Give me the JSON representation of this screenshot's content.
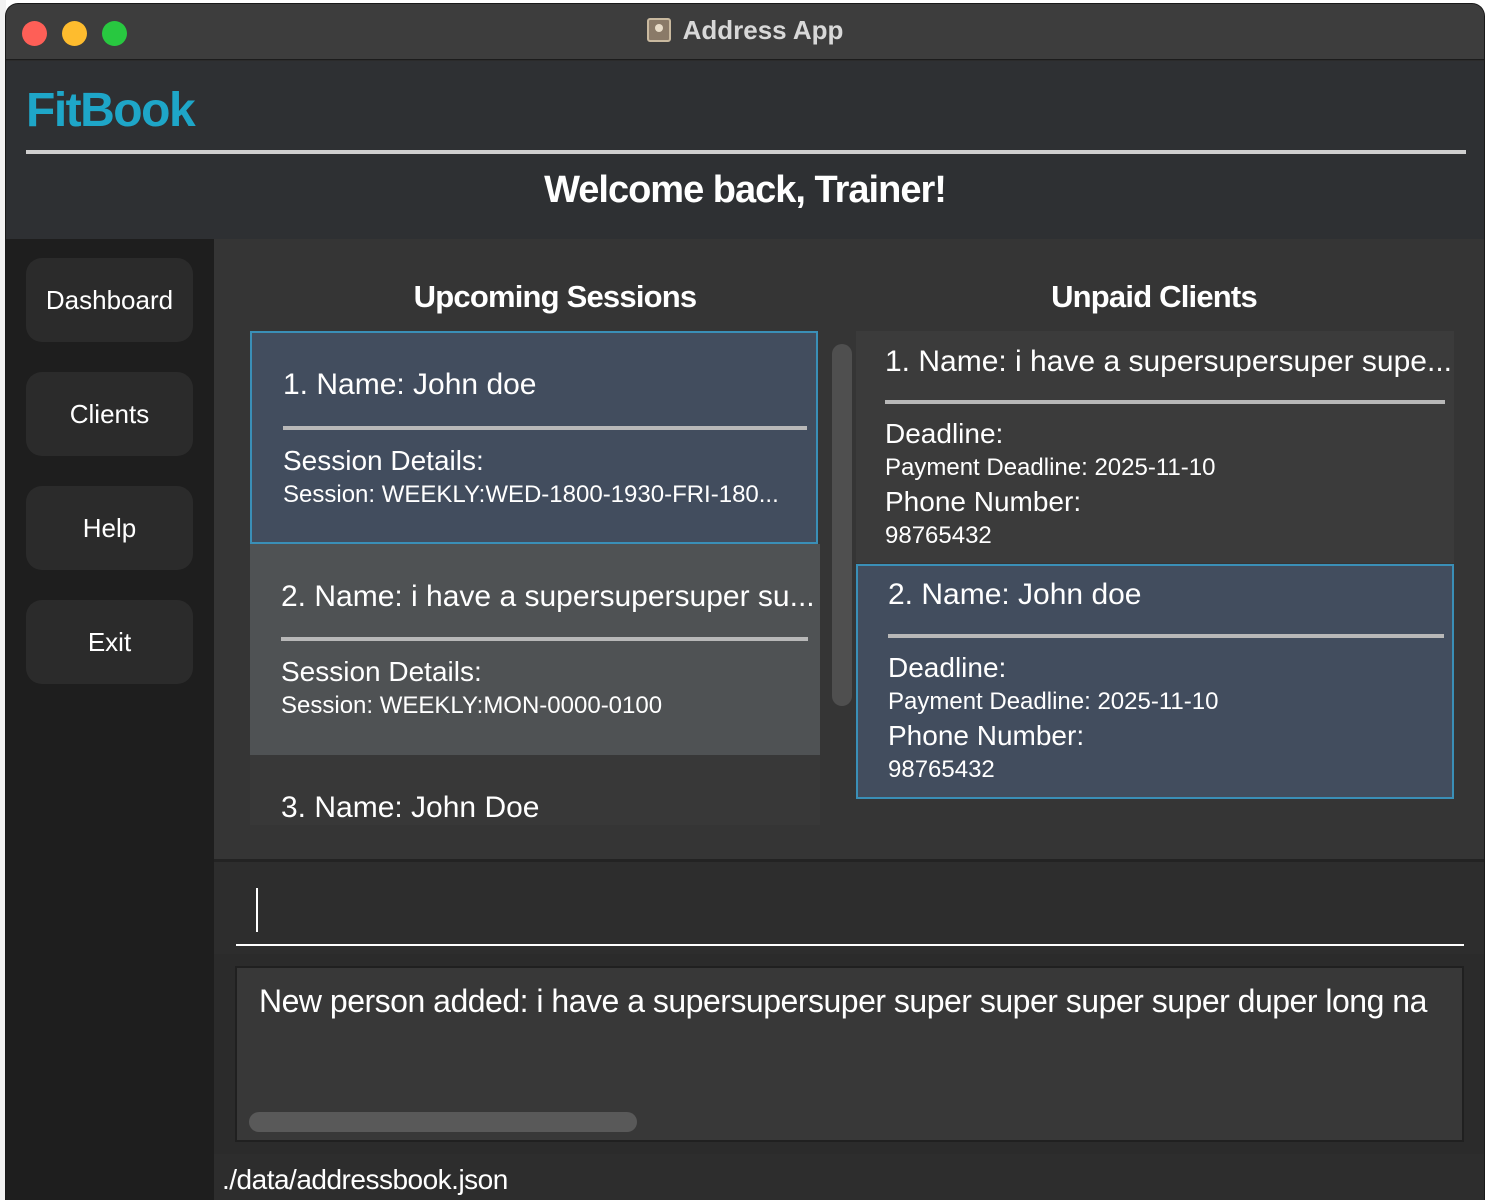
{
  "window": {
    "title": "Address App"
  },
  "brand": "FitBook",
  "welcome": "Welcome back, Trainer!",
  "sidebar": {
    "items": [
      {
        "label": "Dashboard"
      },
      {
        "label": "Clients"
      },
      {
        "label": "Help"
      },
      {
        "label": "Exit"
      }
    ]
  },
  "sessions": {
    "title": "Upcoming Sessions",
    "items": [
      {
        "name": "1. Name: John doe",
        "label": "Session Details:",
        "detail": "Session: WEEKLY:WED-1800-1930-FRI-180..."
      },
      {
        "name": "2. Name: i have a supersupersuper su...",
        "label": "Session Details:",
        "detail": "Session: WEEKLY:MON-0000-0100"
      },
      {
        "name": "3. Name: John Doe"
      }
    ]
  },
  "unpaid": {
    "title": "Unpaid Clients",
    "items": [
      {
        "name": "1. Name: i have a supersupersuper supe...",
        "deadline_label": "Deadline:",
        "deadline": "Payment Deadline: 2025-11-10",
        "phone_label": "Phone Number:",
        "phone": "98765432"
      },
      {
        "name": "2. Name: John doe",
        "deadline_label": "Deadline:",
        "deadline": "Payment Deadline: 2025-11-10",
        "phone_label": "Phone Number:",
        "phone": "98765432"
      }
    ]
  },
  "command": {
    "value": ""
  },
  "result": {
    "text": "New person added: i have a supersupersuper super super super super duper long na"
  },
  "status": {
    "path": "./data/addressbook.json"
  },
  "colors": {
    "brand": "#1ea6c8",
    "selected_card": "#424d5e",
    "selected_border": "#3a8fb7",
    "hover_card": "#4f5254"
  }
}
